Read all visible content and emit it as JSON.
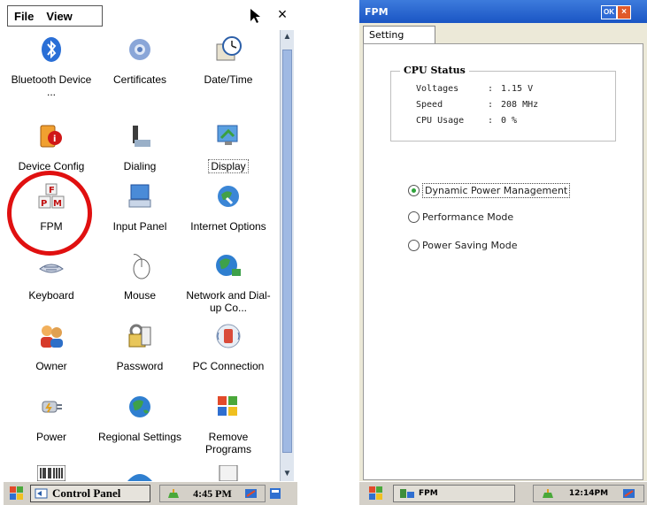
{
  "left_screen": {
    "menu": {
      "file": "File",
      "view": "View"
    },
    "help_label": "?",
    "close_label": "×",
    "icons": [
      {
        "label": "Bluetooth Device ...",
        "icon": "bluetooth-icon"
      },
      {
        "label": "Certificates",
        "icon": "certificates-icon"
      },
      {
        "label": "Date/Time",
        "icon": "clock-icon"
      },
      {
        "label": "Device Config",
        "icon": "device-config-icon"
      },
      {
        "label": "Dialing",
        "icon": "phone-icon"
      },
      {
        "label": "Display",
        "icon": "display-icon"
      },
      {
        "label": "FPM",
        "icon": "fpm-icon"
      },
      {
        "label": "Input Panel",
        "icon": "input-panel-icon"
      },
      {
        "label": "Internet Options",
        "icon": "internet-options-icon"
      },
      {
        "label": "Keyboard",
        "icon": "keyboard-icon"
      },
      {
        "label": "Mouse",
        "icon": "mouse-icon"
      },
      {
        "label": "Network and Dial-up Co...",
        "icon": "network-icon"
      },
      {
        "label": "Owner",
        "icon": "owner-icon"
      },
      {
        "label": "Password",
        "icon": "password-icon"
      },
      {
        "label": "PC Connection",
        "icon": "pc-connection-icon"
      },
      {
        "label": "Power",
        "icon": "power-icon"
      },
      {
        "label": "Regional Settings",
        "icon": "globe-icon"
      },
      {
        "label": "Remove Programs",
        "icon": "remove-programs-icon"
      }
    ],
    "taskbar": {
      "window_label": "Control Panel",
      "time": "4:45 PM"
    }
  },
  "right_screen": {
    "title": "FPM",
    "ok_label": "OK",
    "close_label": "×",
    "tab_label": "Setting",
    "group_title": "CPU Status",
    "stats": [
      {
        "name": "Voltages",
        "sep": ":",
        "value": "1.15 V"
      },
      {
        "name": "Speed",
        "sep": ":",
        "value": "208 MHz"
      },
      {
        "name": "CPU Usage",
        "sep": ":",
        "value": "0 %"
      }
    ],
    "options": [
      {
        "label": "Dynamic Power Management",
        "checked": true
      },
      {
        "label": "Performance Mode",
        "checked": false
      },
      {
        "label": "Power Saving Mode",
        "checked": false
      }
    ],
    "taskbar": {
      "window_label": "FPM",
      "time": "12:14PM"
    }
  },
  "colors": {
    "highlight_circle": "#e01010",
    "title_bar": "#1a55c4",
    "radio_selected": "#2da33a"
  }
}
